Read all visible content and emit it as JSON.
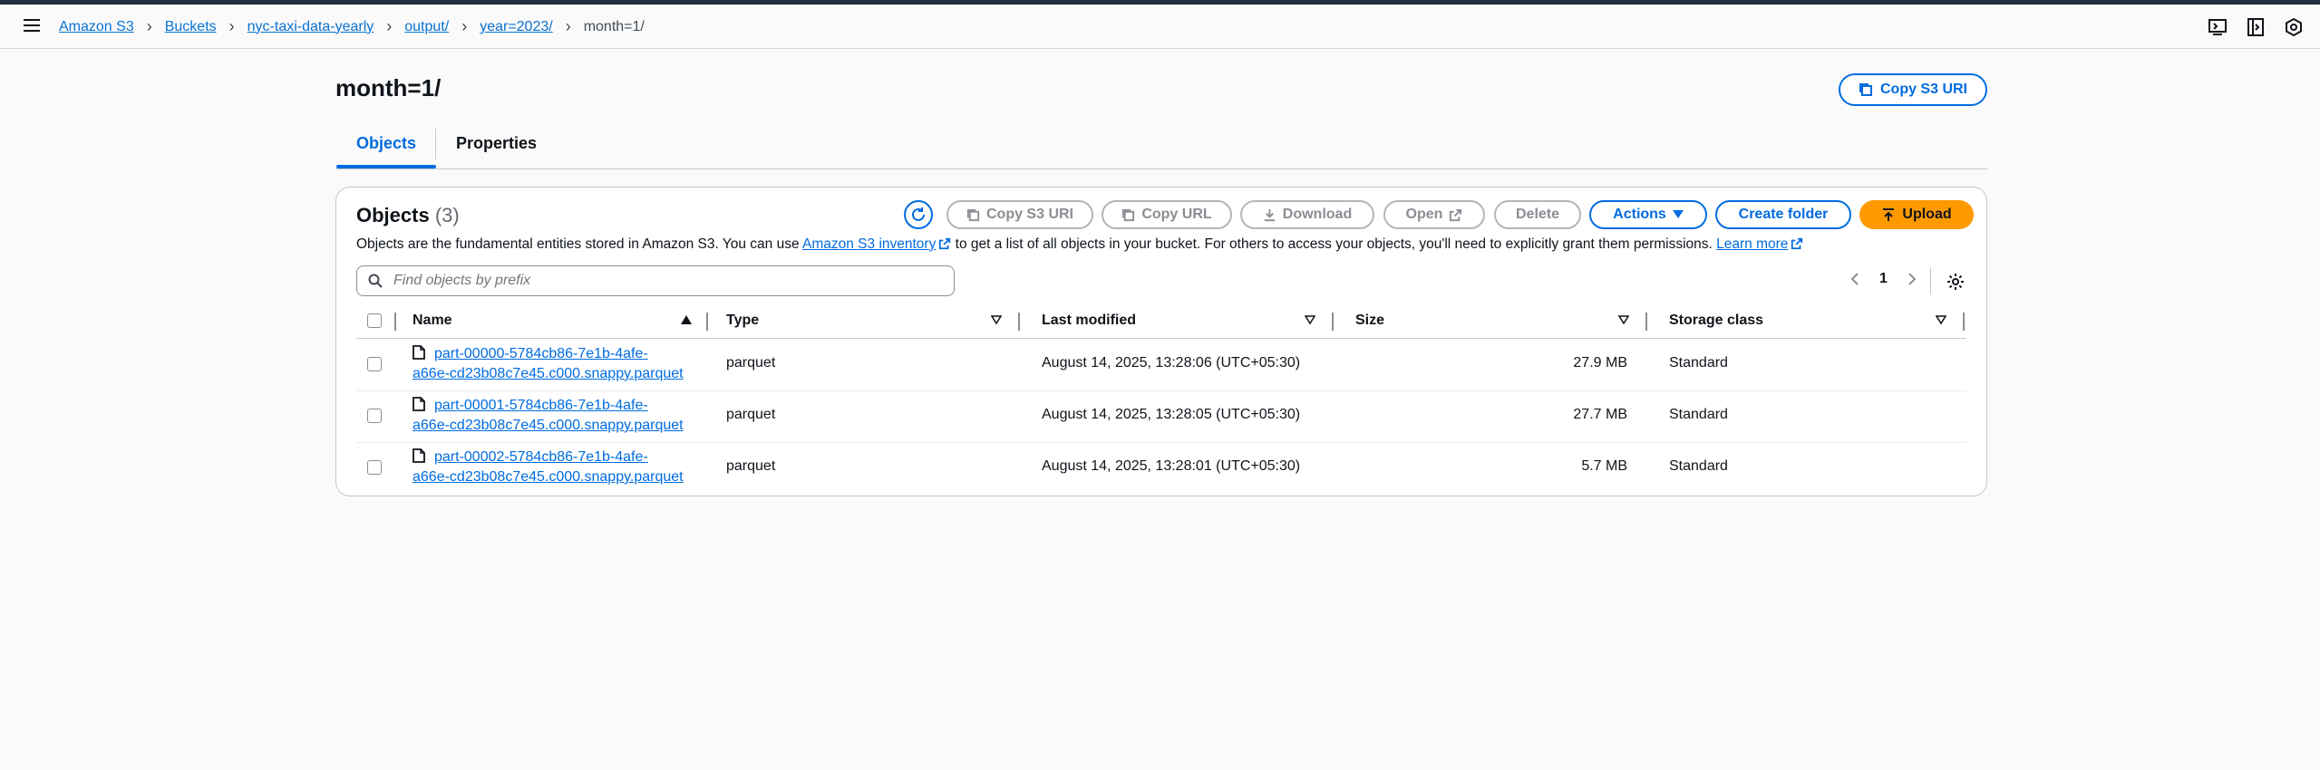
{
  "breadcrumb": [
    "Amazon S3",
    "Buckets",
    "nyc-taxi-data-yearly",
    "output/",
    "year=2023/",
    "month=1/"
  ],
  "page_title": "month=1/",
  "copy_s3_uri_label": "Copy S3 URI",
  "tabs": [
    {
      "label": "Objects"
    },
    {
      "label": "Properties"
    }
  ],
  "objects": {
    "title": "Objects",
    "count": "(3)",
    "description_pre": "Objects are the fundamental entities stored in Amazon S3. You can use",
    "inventory_link": "Amazon S3 inventory",
    "description_mid": "to get a list of all objects in your bucket. For others to access your objects, you'll need to explicitly grant them permissions.",
    "learn_more": "Learn more",
    "buttons": {
      "copy_s3_uri": "Copy S3 URI",
      "copy_url": "Copy URL",
      "download": "Download",
      "open": "Open",
      "delete": "Delete",
      "actions": "Actions",
      "create_folder": "Create folder",
      "upload": "Upload"
    },
    "search_placeholder": "Find objects by prefix",
    "page": "1",
    "columns": {
      "name": "Name",
      "type": "Type",
      "last_modified": "Last modified",
      "size": "Size",
      "storage_class": "Storage class"
    },
    "rows": [
      {
        "name_l1": "part-00000-5784cb86-7e1b-4afe-",
        "name_l2": "a66e-cd23b08c7e45.c000.snappy.parquet",
        "type": "parquet",
        "last_modified": "August 14, 2025, 13:28:06 (UTC+05:30)",
        "size": "27.9 MB",
        "storage_class": "Standard"
      },
      {
        "name_l1": "part-00001-5784cb86-7e1b-4afe-",
        "name_l2": "a66e-cd23b08c7e45.c000.snappy.parquet",
        "type": "parquet",
        "last_modified": "August 14, 2025, 13:28:05 (UTC+05:30)",
        "size": "27.7 MB",
        "storage_class": "Standard"
      },
      {
        "name_l1": "part-00002-5784cb86-7e1b-4afe-",
        "name_l2": "a66e-cd23b08c7e45.c000.snappy.parquet",
        "type": "parquet",
        "last_modified": "August 14, 2025, 13:28:01 (UTC+05:30)",
        "size": "5.7 MB",
        "storage_class": "Standard"
      }
    ]
  },
  "colors": {
    "accent": "#006ce0",
    "upload": "#ff9900",
    "header_bar": "#232f3e"
  }
}
